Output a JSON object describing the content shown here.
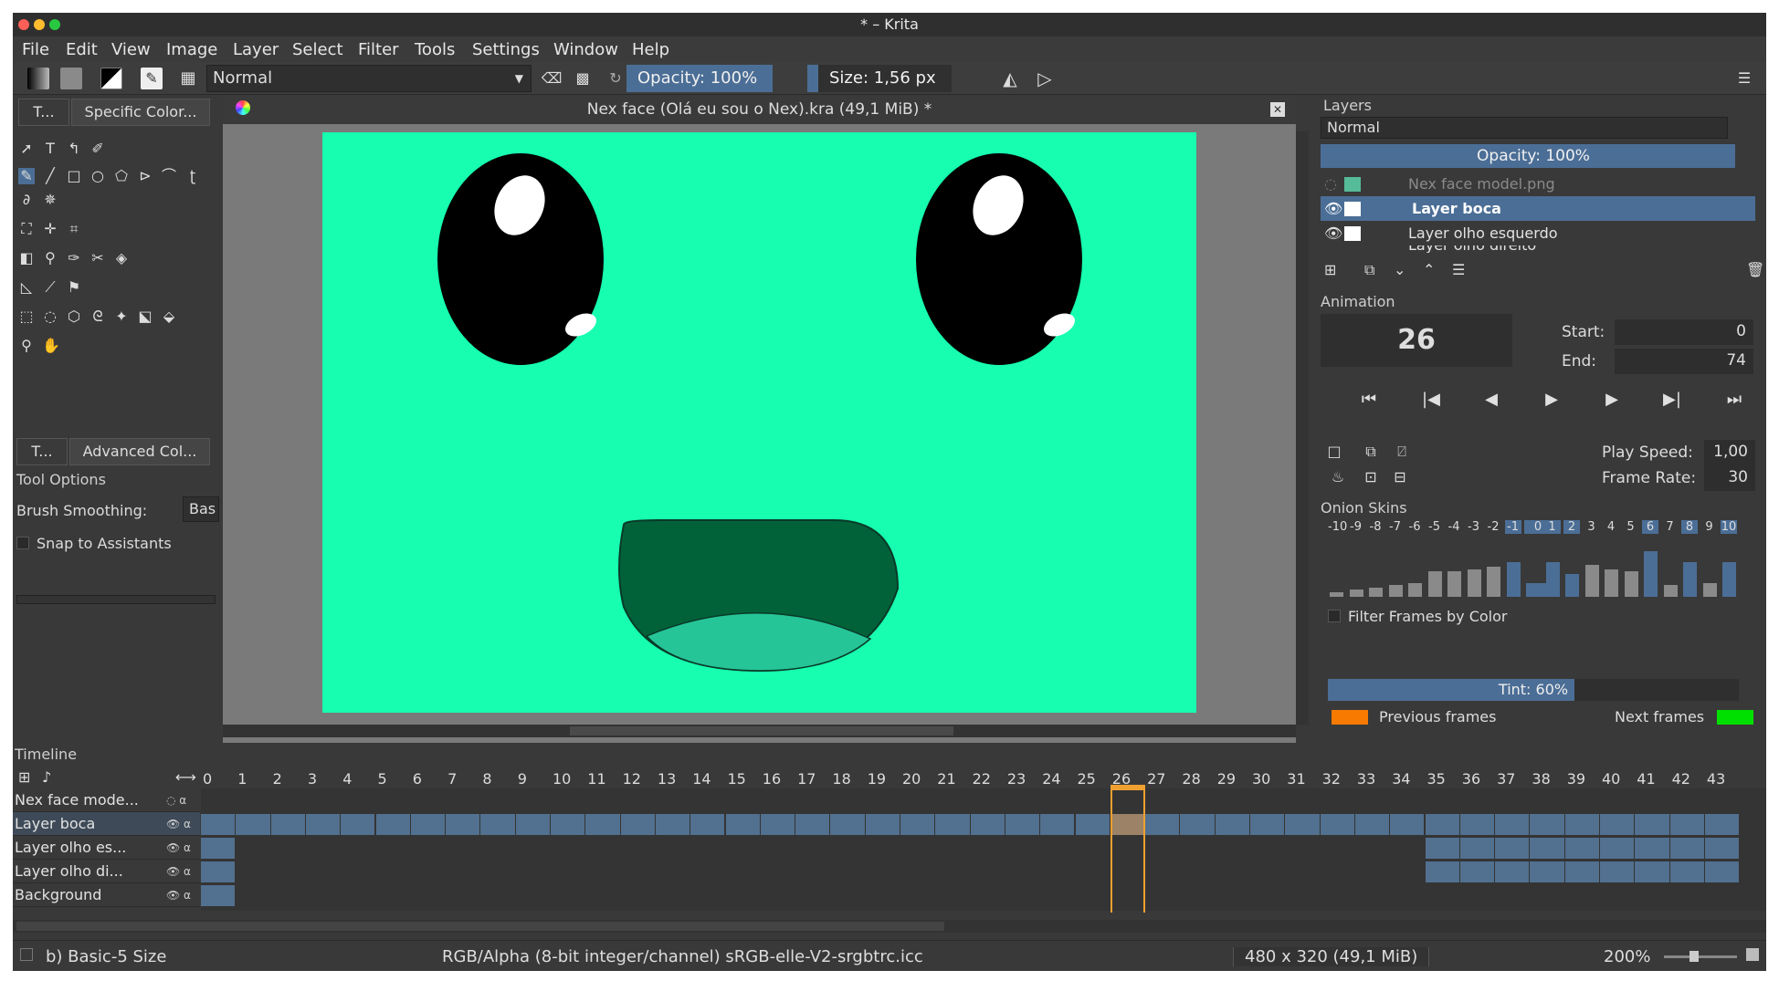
{
  "window": {
    "title": "* – Krita"
  },
  "menu": [
    "File",
    "Edit",
    "View",
    "Image",
    "Layer",
    "Select",
    "Filter",
    "Tools",
    "Settings",
    "Window",
    "Help"
  ],
  "toolbar": {
    "blend_mode": "Normal",
    "opacity": "Opacity: 100%",
    "size": "Size: 1,56 px"
  },
  "left_tabs": {
    "tab1": "T...",
    "tab2": "Specific Color...",
    "tab3": "T...",
    "tab4": "Advanced Col..."
  },
  "tool_options": {
    "title": "Tool Options",
    "smoothing_label": "Brush Smoothing:",
    "smoothing_value": "Bas",
    "snap_label": "Snap to Assistants"
  },
  "document": {
    "title": "Nex face (Olá eu sou o Nex).kra (49,1 MiB) *"
  },
  "layers_panel": {
    "title": "Layers",
    "blend_mode": "Normal",
    "opacity": "Opacity:  100%",
    "layers": [
      {
        "name": "Nex face model.png",
        "selected": false
      },
      {
        "name": "Layer boca",
        "selected": true
      },
      {
        "name": "Layer olho esquerdo",
        "selected": false
      },
      {
        "name": "Layer olho direito",
        "selected": false
      }
    ]
  },
  "animation": {
    "title": "Animation",
    "current_frame": "26",
    "start_label": "Start:",
    "start_value": "0",
    "end_label": "End:",
    "end_value": "74",
    "play_speed_label": "Play Speed:",
    "play_speed_value": "1,00",
    "frame_rate_label": "Frame Rate:",
    "frame_rate_value": "30"
  },
  "onion_skins": {
    "title": "Onion Skins",
    "offsets": [
      "-10",
      "-9",
      "-8",
      "-7",
      "-6",
      "-5",
      "-4",
      "-3",
      "-2",
      "-1",
      "0",
      "1",
      "2",
      "3",
      "4",
      "5",
      "6",
      "7",
      "8",
      "9",
      "10"
    ],
    "active": [
      "-1",
      "1",
      "2",
      "6",
      "8",
      "10"
    ],
    "opacity_levels": [
      0.1,
      0.15,
      0.2,
      0.25,
      0.3,
      0.55,
      0.55,
      0.6,
      0.65,
      0.75,
      0.3,
      0.75,
      0.5,
      0.7,
      0.6,
      0.55,
      1.0,
      0.25,
      0.75,
      0.3,
      0.75
    ],
    "filter_label": "Filter Frames by Color",
    "tint": "Tint: 60%",
    "tint_level": 0.6,
    "previous_label": "Previous frames",
    "next_label": "Next frames",
    "previous_color": "#f97a00",
    "next_color": "#00e000"
  },
  "timeline": {
    "title": "Timeline",
    "frames": [
      "0",
      "1",
      "2",
      "3",
      "4",
      "5",
      "6",
      "7",
      "8",
      "9",
      "10",
      "11",
      "12",
      "13",
      "14",
      "15",
      "16",
      "17",
      "18",
      "19",
      "20",
      "21",
      "22",
      "23",
      "24",
      "25",
      "26",
      "27",
      "28",
      "29",
      "30",
      "31",
      "32",
      "33",
      "34",
      "35",
      "36",
      "37",
      "38",
      "39",
      "40",
      "41",
      "42",
      "43"
    ],
    "current_frame": 26,
    "rows": [
      "Nex face mode...",
      "Layer boca",
      "Layer olho es...",
      "Layer olho di...",
      "Background"
    ]
  },
  "status": {
    "brush": "b) Basic-5 Size",
    "color_profile": "RGB/Alpha (8-bit integer/channel)  sRGB-elle-V2-srgbtrc.icc",
    "dimensions": "480 x 320 (49,1 MiB)",
    "zoom": "200%"
  },
  "colors": {
    "canvas": "#17feb0",
    "accent": "#4b6e96",
    "mouth": "#016239",
    "tongue": "#25c597"
  }
}
